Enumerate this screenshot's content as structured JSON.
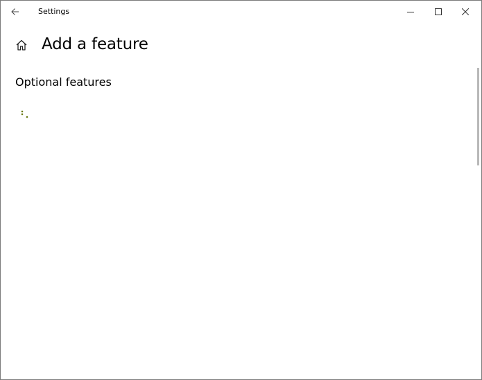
{
  "window": {
    "title": "Settings"
  },
  "header": {
    "page_title": "Add a feature"
  },
  "main": {
    "section_title": "Optional features",
    "loading": true
  },
  "icons": {
    "back": "back-arrow-icon",
    "home": "home-icon",
    "minimize": "minimize-icon",
    "maximize": "maximize-icon",
    "close": "close-icon",
    "spinner": "loading-spinner-icon"
  },
  "colors": {
    "spinner": "#6b7a14",
    "background": "#ffffff",
    "text": "#000000"
  }
}
